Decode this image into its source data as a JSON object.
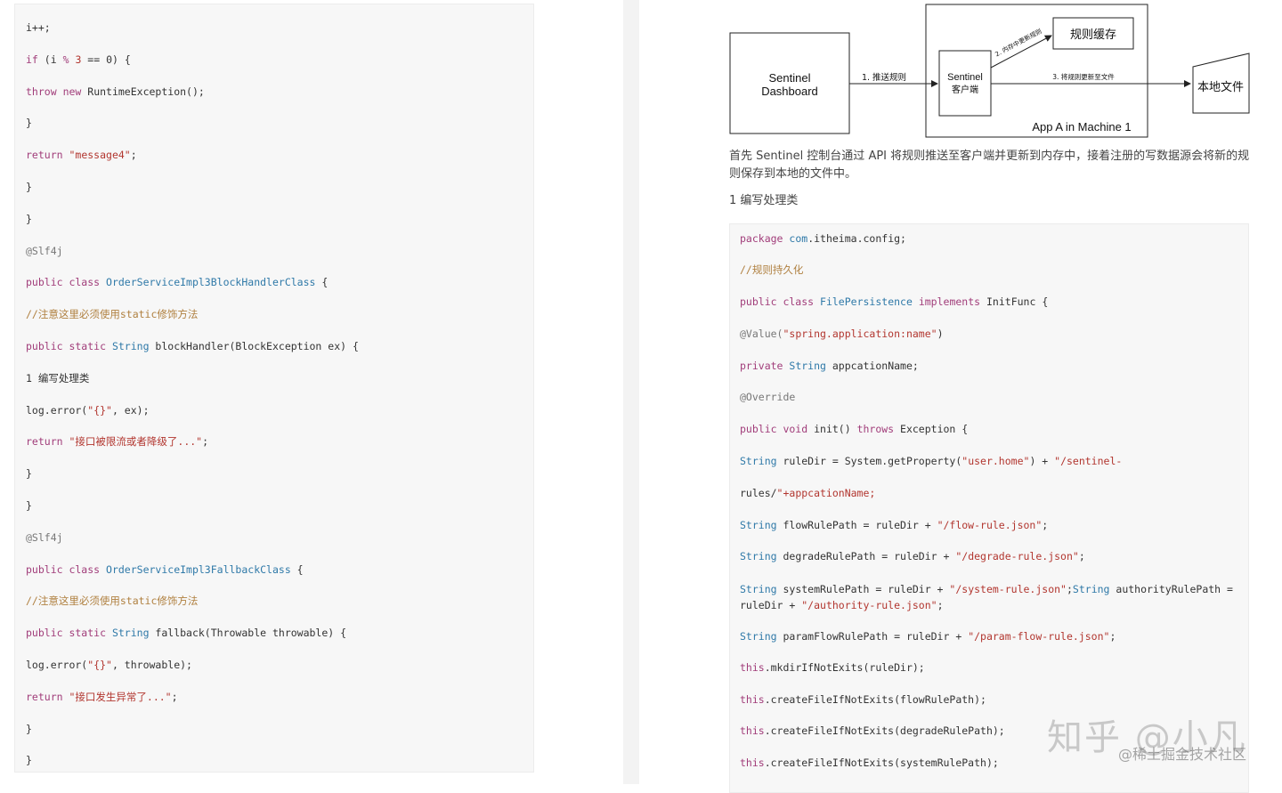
{
  "left_code": [
    {
      "kind": "plain",
      "text": "i++;"
    },
    {
      "kind": "if",
      "text": "if (i % 3 == 0) {"
    },
    {
      "kind": "throw",
      "text": "throw new RuntimeException();"
    },
    {
      "kind": "plain",
      "text": "}"
    },
    {
      "kind": "return",
      "kw": "return",
      "str": "\"message4\"",
      "tail": ";"
    },
    {
      "kind": "plain",
      "text": "}"
    },
    {
      "kind": "plain",
      "text": "}"
    },
    {
      "kind": "anno",
      "text": "@Slf4j"
    },
    {
      "kind": "class",
      "kw": "public class",
      "name": "OrderServiceImpl3BlockHandlerClass",
      "tail": " {"
    },
    {
      "kind": "comment",
      "text": "//注意这里必须使用static修饰方法"
    },
    {
      "kind": "method",
      "kw": "public static",
      "type": "String",
      "rest": "blockHandler(BlockException ex) {"
    },
    {
      "kind": "plain",
      "text": "1 编写处理类"
    },
    {
      "kind": "log",
      "pre": "log.error(",
      "str": "\"{}\"",
      "tail": ", ex);"
    },
    {
      "kind": "return",
      "kw": "return",
      "str": "\"接口被限流或者降级了...\"",
      "tail": ";"
    },
    {
      "kind": "plain",
      "text": "}"
    },
    {
      "kind": "plain",
      "text": "}"
    },
    {
      "kind": "anno",
      "text": "@Slf4j"
    },
    {
      "kind": "class",
      "kw": "public class",
      "name": "OrderServiceImpl3FallbackClass",
      "tail": " {"
    },
    {
      "kind": "comment",
      "text": "//注意这里必须使用static修饰方法"
    },
    {
      "kind": "method",
      "kw": "public static",
      "type": "String",
      "rest": "fallback(Throwable throwable) {"
    },
    {
      "kind": "log",
      "pre": "log.error(",
      "str": "\"{}\"",
      "tail": ", throwable);"
    },
    {
      "kind": "return",
      "kw": "return",
      "str": "\"接口发生异常了...\"",
      "tail": ";"
    },
    {
      "kind": "plain",
      "text": "}"
    },
    {
      "kind": "plain",
      "text": "}"
    }
  ],
  "diagram": {
    "dashboard_line1": "Sentinel",
    "dashboard_line2": "Dashboard",
    "arrow1_label": "1. 推送规则",
    "client_line1": "Sentinel",
    "client_line2": "客户端",
    "cache_label": "规则缓存",
    "arrow2_label": "2. 内存中更新规则",
    "arrow3_label": "3. 将规则更新至文件",
    "file_label": "本地文件",
    "machine_label": "App A in Machine 1"
  },
  "paragraph": "首先 Sentinel 控制台通过 API 将规则推送至客户端并更新到内存中，接着注册的写数据源会将新的规则保存到本地的文件中。",
  "section_heading": "1 编写处理类",
  "right_code": [
    {
      "kind": "pkg",
      "kw": "package",
      "ty": "com",
      "tail": ".itheima.config;"
    },
    {
      "kind": "comment",
      "text": "//规则持久化"
    },
    {
      "kind": "class",
      "kw": "public class",
      "name": "FilePersistence",
      "kw2": "implements",
      "tail": " InitFunc {"
    },
    {
      "kind": "value",
      "pre": "@Value(",
      "str": "\"spring.application:name\"",
      "tail": ")"
    },
    {
      "kind": "field",
      "kw": "private",
      "type": "String",
      "rest": "appcationName;"
    },
    {
      "kind": "anno",
      "text": "@Override"
    },
    {
      "kind": "init",
      "kw": "public void",
      "mid": "init()",
      "kw2": "throws",
      "tail": " Exception {"
    },
    {
      "kind": "decl",
      "type": "String",
      "pre": "ruleDir = System.getProperty(",
      "str": "\"user.home\"",
      "tail": ") + ",
      "str2": "\"/sentinel-"
    },
    {
      "kind": "cont",
      "pre": "rules/",
      "str": "\"+appcationName;"
    },
    {
      "kind": "decl2",
      "type": "String",
      "pre": "flowRulePath = ruleDir + ",
      "str": "\"/flow-rule.json\"",
      "tail": ";"
    },
    {
      "kind": "decl2",
      "type": "String",
      "pre": "degradeRulePath = ruleDir + ",
      "str": "\"/degrade-rule.json\"",
      "tail": ";"
    },
    {
      "kind": "decl3",
      "type": "String",
      "pre": "systemRulePath = ruleDir + ",
      "str": "\"/system-rule.json\"",
      "mid": ";",
      "type2": "String",
      "tail": " authorityRulePath =",
      "line2pre": "ruleDir + ",
      "line2str": "\"/authority-rule.json\"",
      "line2tail": ";"
    },
    {
      "kind": "decl2",
      "type": "String",
      "pre": "paramFlowRulePath = ruleDir + ",
      "str": "\"/param-flow-rule.json\"",
      "tail": ";"
    },
    {
      "kind": "call",
      "kw": "this",
      "tail": ".mkdirIfNotExits(ruleDir);"
    },
    {
      "kind": "call",
      "kw": "this",
      "tail": ".createFileIfNotExits(flowRulePath);"
    },
    {
      "kind": "call",
      "kw": "this",
      "tail": ".createFileIfNotExits(degradeRulePath);"
    },
    {
      "kind": "call",
      "kw": "this",
      "tail": ".createFileIfNotExits(systemRulePath);"
    }
  ],
  "watermark": {
    "main": "知乎 @小凡",
    "sub": "@稀土掘金技术社区"
  }
}
